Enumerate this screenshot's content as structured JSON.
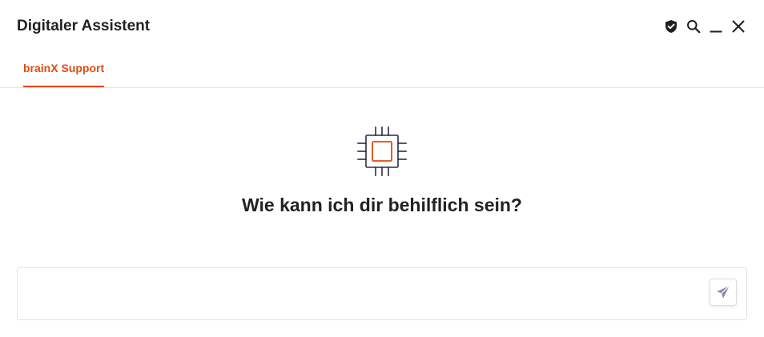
{
  "window": {
    "title": "Digitaler Assistent"
  },
  "title_icons": [
    "shield-check-icon",
    "search-icon",
    "minimize-icon",
    "close-icon"
  ],
  "tabs": [
    {
      "label": "brainX Support",
      "active": true
    }
  ],
  "main": {
    "icon": "cpu-chip-icon",
    "headline": "Wie kann ich dir behilflich sein?"
  },
  "composer": {
    "value": "",
    "placeholder": "",
    "send_icon": "send-icon"
  },
  "colors": {
    "accent": "#e4480f",
    "text": "#222222",
    "chip_outline": "#2b2d42",
    "divider": "#e6e6e6",
    "send_icon": "#8a8fa0"
  }
}
